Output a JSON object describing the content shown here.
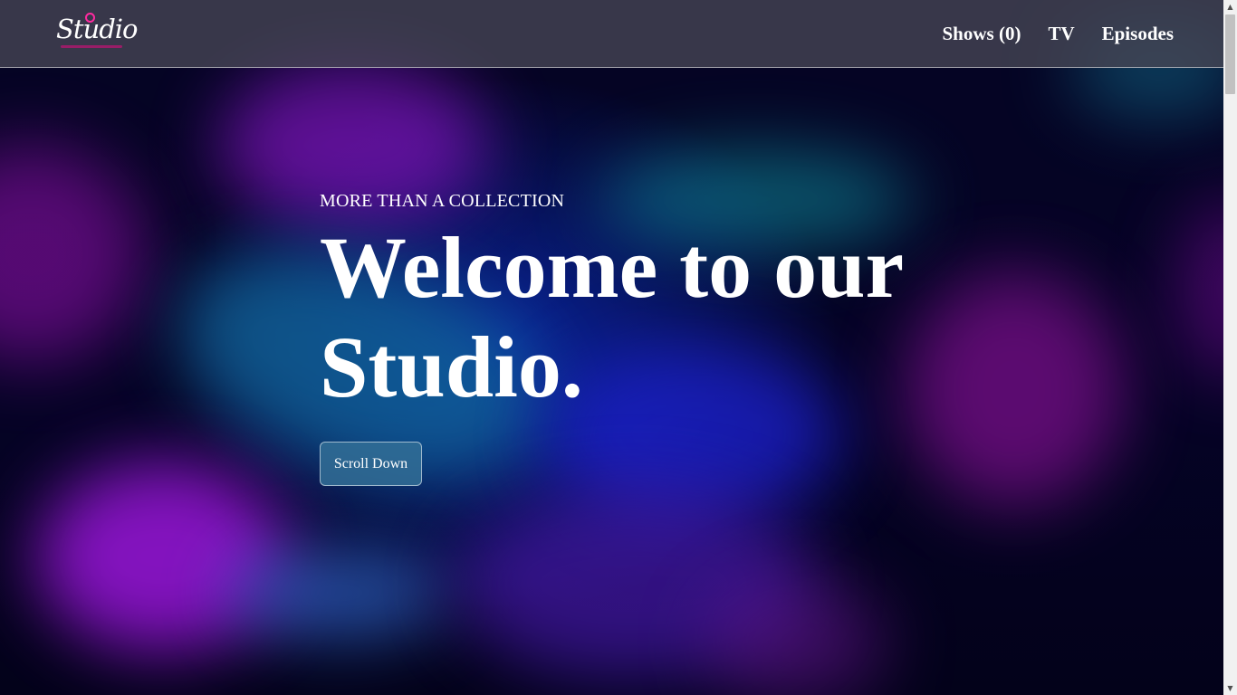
{
  "header": {
    "logo_text": "Studio",
    "nav": [
      {
        "label": "Shows (0)"
      },
      {
        "label": "TV"
      },
      {
        "label": "Episodes"
      }
    ]
  },
  "hero": {
    "eyebrow": "MORE THAN A COLLECTION",
    "title": "Welcome to our Studio.",
    "button_label": "Scroll Down"
  },
  "scrollbar": {
    "up_icon": "▲",
    "down_icon": "▼"
  },
  "colors": {
    "logo_accent": "#ff2aa0",
    "header_bg": "#46465a",
    "button_bg": "#326e96",
    "text": "#ffffff"
  }
}
